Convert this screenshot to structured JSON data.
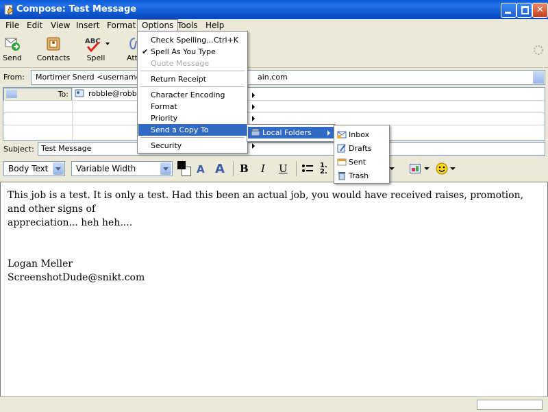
{
  "window": {
    "title": "Compose: Test Message"
  },
  "menubar": {
    "items": [
      "File",
      "Edit",
      "View",
      "Insert",
      "Format",
      "Options",
      "Tools",
      "Help"
    ]
  },
  "toolbar": {
    "send": "Send",
    "contacts": "Contacts",
    "spell": "Spell",
    "attach": "Att"
  },
  "address": {
    "from_label": "From:",
    "from_value": "Mortimer Snerd <username@d",
    "from_value_tail": "ain.com",
    "to_label": "To:",
    "to_value": "robble@robble",
    "subject_label": "Subject:",
    "subject_value": "Test Message"
  },
  "format": {
    "paragraph_style": "Body Text",
    "font": "Variable Width"
  },
  "editor": {
    "line1": "This job is a test.  It is only a test.  Had this been an actual job, you would have received raises, promotion, and other signs of",
    "line2": "appreciation... heh heh....",
    "sig_name": "Logan Meller",
    "sig_email": "ScreenshotDude@snikt.com"
  },
  "options_menu": {
    "check_spelling": "Check Spelling...",
    "check_spelling_shortcut": "Ctrl+K",
    "spell_as_you_type": "Spell As You Type",
    "quote_message": "Quote Message",
    "return_receipt": "Return Receipt",
    "character_encoding": "Character Encoding",
    "format": "Format",
    "priority": "Priority",
    "send_a_copy_to": "Send a Copy To",
    "security": "Security"
  },
  "copy_submenu": {
    "local_folders": "Local Folders"
  },
  "folders_submenu": {
    "inbox": "Inbox",
    "drafts": "Drafts",
    "sent": "Sent",
    "trash": "Trash"
  },
  "colors": {
    "accent": "#316ac5",
    "titlebar": "#0a5bd6"
  }
}
